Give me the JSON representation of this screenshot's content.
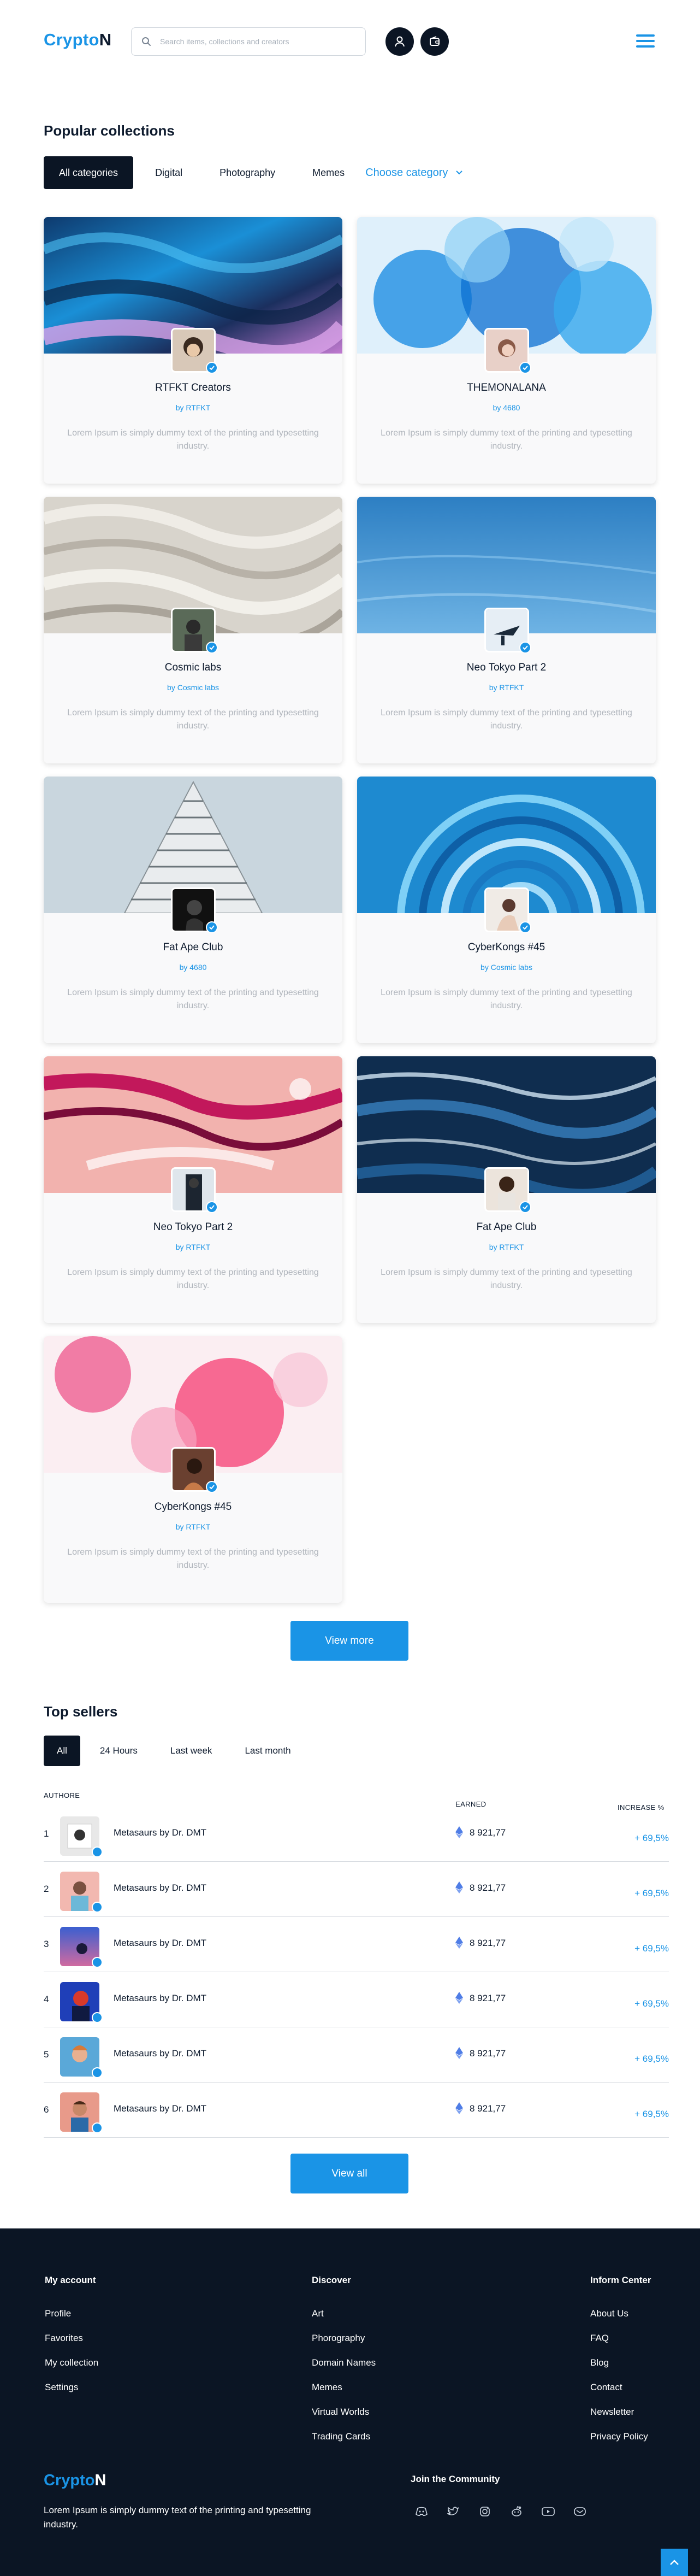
{
  "header": {
    "logo_main": "Crypto",
    "logo_accent": "N",
    "search_placeholder": "Search items, collections and creators",
    "icons": [
      "search-icon",
      "user-icon",
      "wallet-icon",
      "menu-icon"
    ]
  },
  "popular": {
    "title": "Popular collections",
    "tabs": [
      "All categories",
      "Digital",
      "Photography",
      "Memes"
    ],
    "choose_label": "Choose category",
    "cards": [
      {
        "name": "RTFKT Creators",
        "by": "by RTFKT",
        "desc": "Lorem Ipsum is simply dummy text of the printing and typesetting industry."
      },
      {
        "name": "THEMONALANA",
        "by": "by 4680",
        "desc": "Lorem Ipsum is simply dummy text of the printing and typesetting industry."
      },
      {
        "name": "Cosmic labs",
        "by": "by Cosmic labs",
        "desc": "Lorem Ipsum is simply dummy text of the printing and typesetting industry."
      },
      {
        "name": "Neo Tokyo Part 2",
        "by": "by RTFKT",
        "desc": "Lorem Ipsum is simply dummy text of the printing and typesetting industry."
      },
      {
        "name": "Fat Ape Club",
        "by": "by 4680",
        "desc": "Lorem Ipsum is simply dummy text of the printing and typesetting industry."
      },
      {
        "name": "CyberKongs #45",
        "by": "by Cosmic labs",
        "desc": "Lorem Ipsum is simply dummy text of the printing and typesetting industry."
      },
      {
        "name": "Neo Tokyo Part 2",
        "by": "by RTFKT",
        "desc": "Lorem Ipsum is simply dummy text of the printing and typesetting industry."
      },
      {
        "name": "Fat Ape Club",
        "by": "by RTFKT",
        "desc": "Lorem Ipsum is simply dummy text of the printing and typesetting industry."
      },
      {
        "name": "CyberKongs #45",
        "by": "by RTFKT",
        "desc": "Lorem Ipsum is simply dummy text of the printing and typesetting industry."
      }
    ],
    "view_more": "View more"
  },
  "sellers": {
    "title": "Top sellers",
    "tabs": [
      "All",
      "24 Hours",
      "Last week",
      "Last month"
    ],
    "col_authors": "AUTHORE",
    "col_earned": "EARNED",
    "col_increase": "INCREASE %",
    "rows": [
      {
        "num": "1",
        "name": "Metasaurs by Dr. DMT",
        "earned": "8 921,77",
        "increase": "+ 69,5%"
      },
      {
        "num": "2",
        "name": "Metasaurs by Dr. DMT",
        "earned": "8 921,77",
        "increase": "+ 69,5%"
      },
      {
        "num": "3",
        "name": "Metasaurs by Dr. DMT",
        "earned": "8 921,77",
        "increase": "+ 69,5%"
      },
      {
        "num": "4",
        "name": "Metasaurs by Dr. DMT",
        "earned": "8 921,77",
        "increase": "+ 69,5%"
      },
      {
        "num": "5",
        "name": "Metasaurs by Dr. DMT",
        "earned": "8 921,77",
        "increase": "+ 69,5%"
      },
      {
        "num": "6",
        "name": "Metasaurs by Dr. DMT",
        "earned": "8 921,77",
        "increase": "+ 69,5%"
      }
    ],
    "view_all": "View all"
  },
  "footer": {
    "col1": {
      "title": "My account",
      "items": [
        "Profile",
        "Favorites",
        "My collection",
        "Settings"
      ]
    },
    "col2": {
      "title": "Discover",
      "items": [
        "Art",
        "Phorography",
        "Domain Names",
        "Memes",
        "Virtual Worlds",
        "Trading Cards"
      ]
    },
    "col3": {
      "title": "Inform Center",
      "items": [
        "About Us",
        "FAQ",
        "Blog",
        "Contact",
        "Newsletter",
        "Privacy Policy"
      ]
    },
    "logo_main": "Crypto",
    "logo_accent": "N",
    "tagline": "Lorem Ipsum is simply dummy text of the printing and typesetting industry.",
    "community_title": "Join the Community",
    "social_icons": [
      "discord-icon",
      "twitter-icon",
      "instagram-icon",
      "reddit-icon",
      "youtube-icon",
      "mail-icon"
    ]
  },
  "colors": {
    "accent": "#1a94e6",
    "dark": "#0b1524"
  }
}
